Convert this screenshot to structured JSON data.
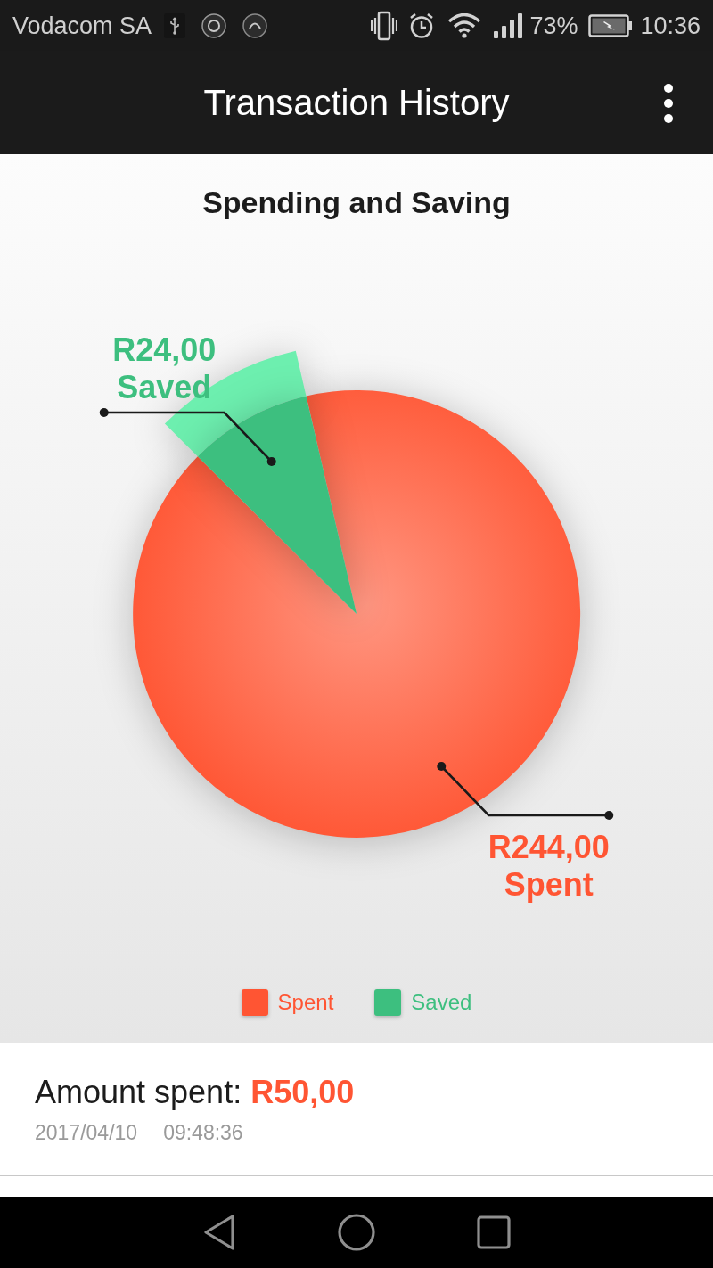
{
  "status_bar": {
    "carrier": "Vodacom SA",
    "battery": "73%",
    "time": "10:36"
  },
  "app_bar": {
    "title": "Transaction History"
  },
  "chart": {
    "chart_data": {
      "type": "pie",
      "title": "Spending and Saving",
      "categories": [
        "Spent",
        "Saved"
      ],
      "values": [
        244,
        24
      ],
      "value_labels": [
        "R244,00",
        "R24,00"
      ],
      "legend": "bottom"
    },
    "slices": [
      {
        "label": "Spent",
        "selected": false
      },
      {
        "label": "Saved",
        "selected": true
      }
    ],
    "legend": [
      {
        "color": "#ff5533"
      },
      {
        "color": "#3dbf7f"
      }
    ]
  },
  "transactions": [
    {
      "summary": "Amount spent: **R50,00**",
      "date": "2017/04/10",
      "time": "09:48:36"
    }
  ]
}
